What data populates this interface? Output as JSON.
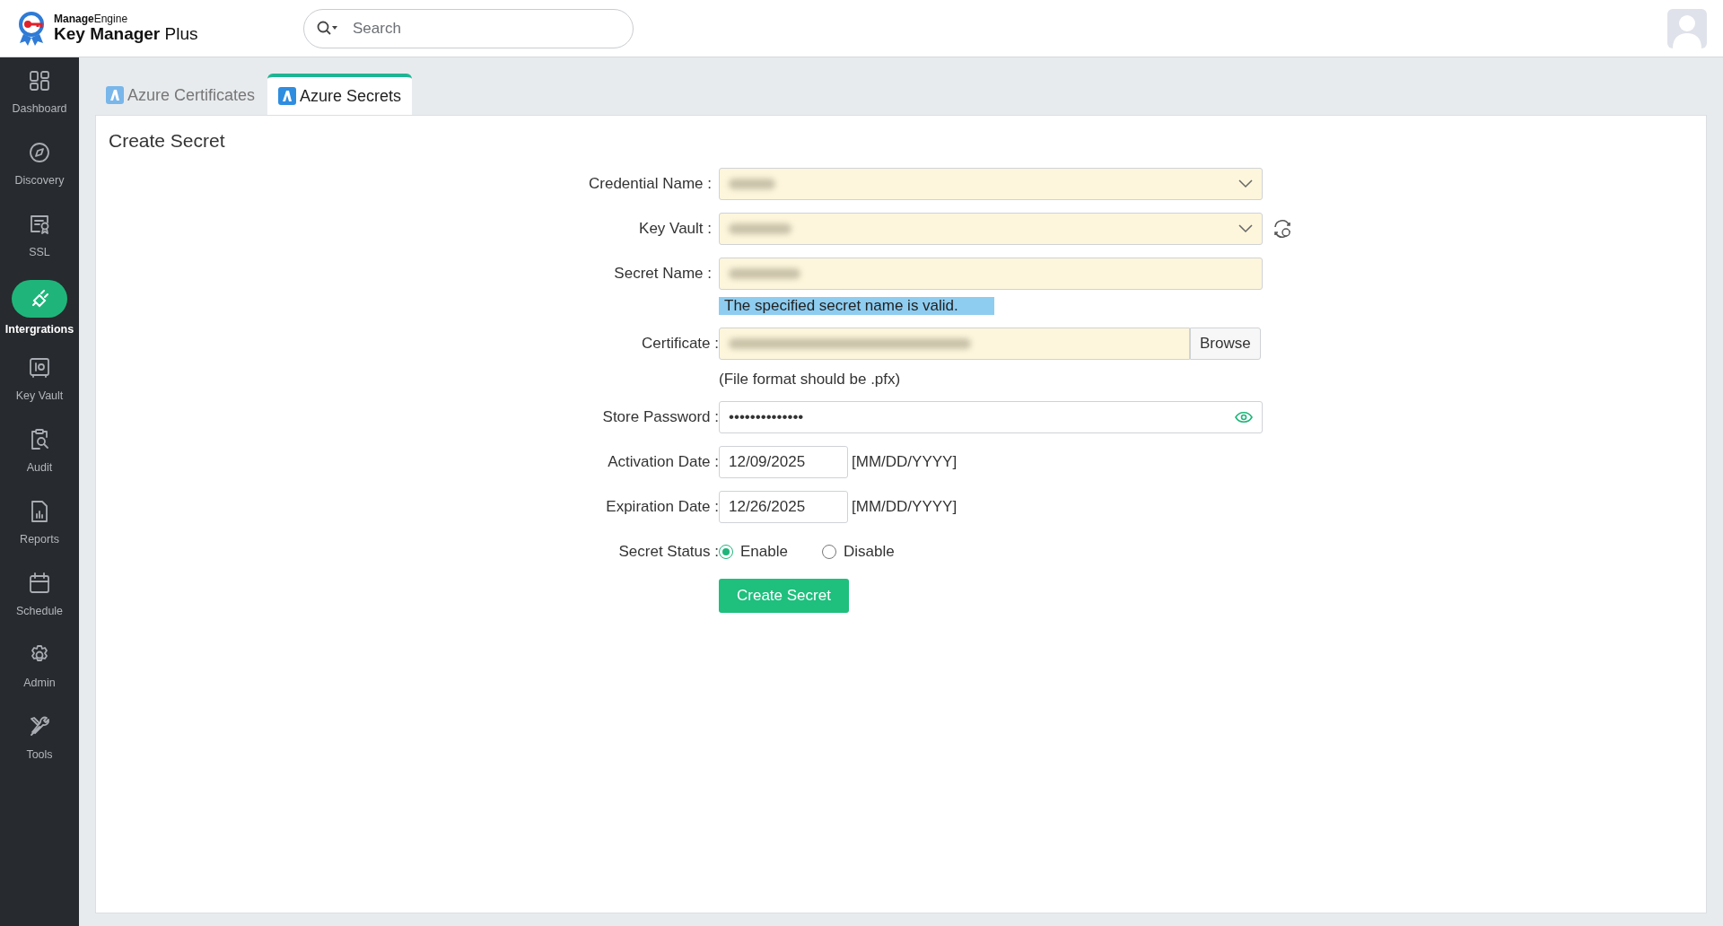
{
  "brand": {
    "company": "**Manage**Engine",
    "product": "**Key Manager** Plus"
  },
  "search": {
    "placeholder": "Search"
  },
  "sidebar": {
    "items": [
      {
        "label": "Dashboard",
        "selected": false
      },
      {
        "label": "Discovery",
        "selected": false
      },
      {
        "label": "SSL",
        "selected": false
      },
      {
        "label": "Intergrations",
        "selected": true
      },
      {
        "label": "Key Vault",
        "selected": false
      },
      {
        "label": "Audit",
        "selected": false
      },
      {
        "label": "Reports",
        "selected": false
      },
      {
        "label": "Schedule",
        "selected": false
      },
      {
        "label": "Admin",
        "selected": false
      },
      {
        "label": "Tools",
        "selected": false
      }
    ]
  },
  "tabs": [
    {
      "label": "Azure Certificates",
      "selected": false
    },
    {
      "label": "Azure Secrets",
      "selected": true
    }
  ],
  "form": {
    "title": "Create Secret",
    "fields": [
      {
        "kind": "select",
        "label": "Credential Name :"
      },
      {
        "kind": "select",
        "label": "Key Vault :",
        "refresh": true
      },
      {
        "kind": "text",
        "label": "Secret Name :",
        "message": "The specified secret name is valid."
      },
      {
        "kind": "file",
        "label": "Certificate :",
        "button": "Browse",
        "hint": "(File format should be .pfx)"
      },
      {
        "kind": "password",
        "label": "Store Password :",
        "value": "••••••••••••••"
      },
      {
        "kind": "date",
        "label": "Activation Date :",
        "value": "12/09/2025",
        "format": "[MM/DD/YYYY]"
      },
      {
        "kind": "date",
        "label": "Expiration Date :",
        "value": "12/26/2025",
        "format": "[MM/DD/YYYY]"
      },
      {
        "kind": "radio",
        "label": "Secret Status :",
        "options": [
          {
            "label": "Enable",
            "selected": true
          },
          {
            "label": "Disable",
            "selected": false
          }
        ]
      }
    ],
    "submit": "Create Secret"
  }
}
